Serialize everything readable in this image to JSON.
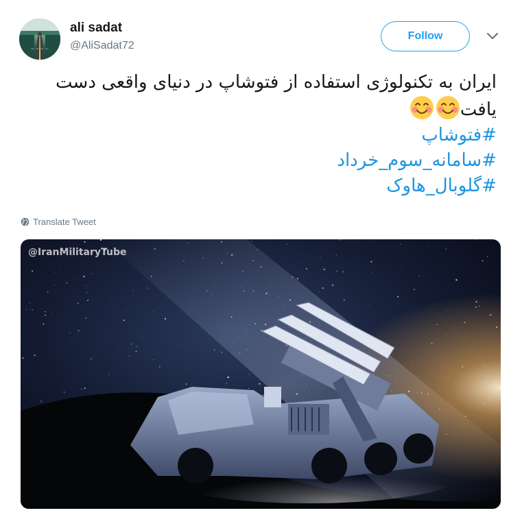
{
  "author": {
    "name": "ali sadat",
    "handle": "@AliSadat72",
    "avatar": "avatar-icon"
  },
  "follow_label": "Follow",
  "menu_icon": "chevron-down-icon",
  "tweet": {
    "line1": "ایران به تکنولوژی استفاده از فتوشاپ در دنیای واقعی دست",
    "line2": "یافت",
    "emoji": "smiling-face-icon",
    "hashtags": [
      "#فتوشاپ",
      "#سامانه_سوم_خرداد",
      "#گلوبال_هاوک"
    ]
  },
  "translate_label": "Translate Tweet",
  "translate_icon": "globe-icon",
  "media": {
    "watermark": "@IranMilitaryTube"
  },
  "colors": {
    "accent": "#1da1f2",
    "hashtag": "#1b95e0",
    "secondary_text": "#657786"
  }
}
